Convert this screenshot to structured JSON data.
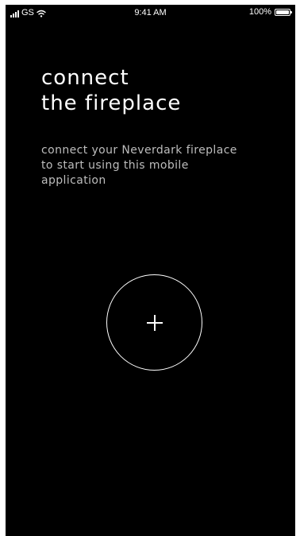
{
  "status_bar": {
    "carrier": "GS",
    "time": "9:41 AM",
    "battery_percent": "100%",
    "battery_level": 1.0,
    "icons": [
      "signal-icon",
      "wifi-icon",
      "battery-icon"
    ]
  },
  "main": {
    "title_line1": "connect",
    "title_line2": "the fireplace",
    "subtitle_line1": "connect your Neverdark fireplace",
    "subtitle_line2": "to start using this mobile",
    "subtitle_line3": "application",
    "add_button_icon": "plus-icon"
  },
  "colors": {
    "background": "#000000",
    "text_primary": "#ffffff",
    "text_secondary": "#bdbdbd"
  }
}
